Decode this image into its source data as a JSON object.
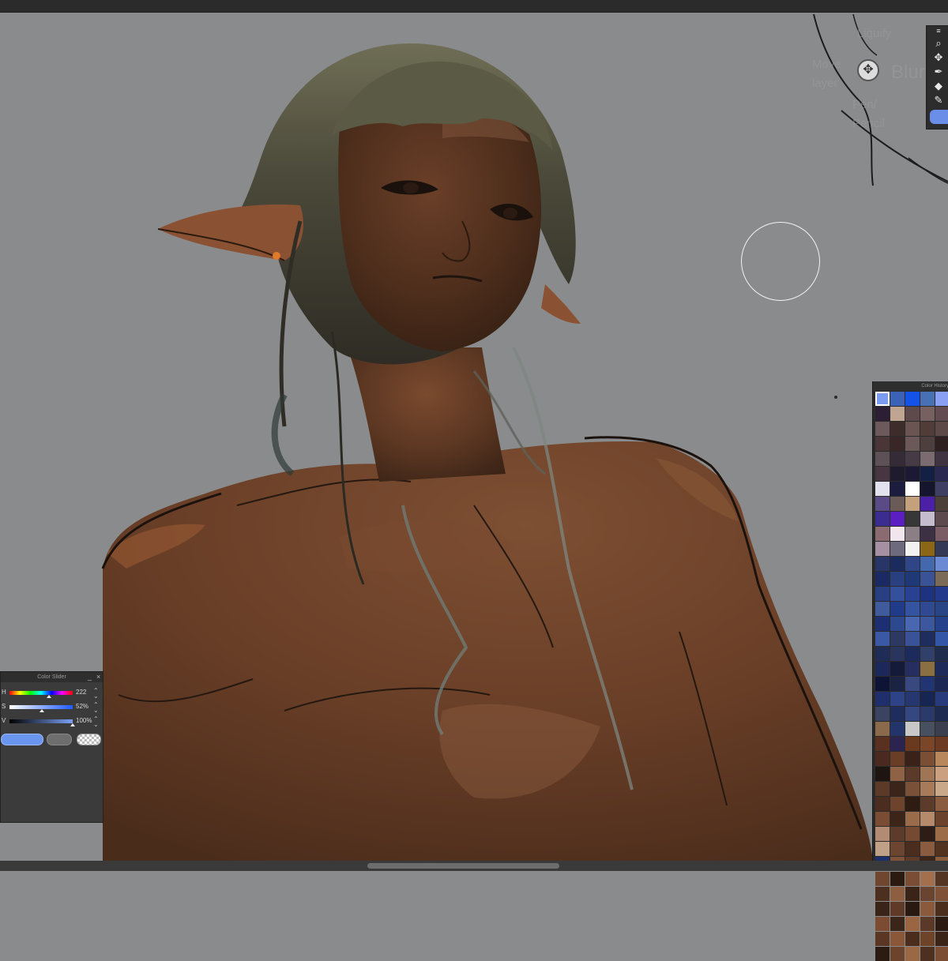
{
  "gesture_hints": {
    "liquify": "Liquify",
    "move_layer": "Move layer",
    "blur": "Blur",
    "pen_pencil": "Pen/ Pencil"
  },
  "toolbar": {
    "tools": [
      "search-icon",
      "move-icon",
      "pen-icon",
      "fill-icon",
      "pencil-icon"
    ]
  },
  "color_slider": {
    "title": "Color Slider",
    "rows": [
      {
        "label": "H",
        "value": "222",
        "fraction": 0.62
      },
      {
        "label": "S",
        "value": "52%",
        "fraction": 0.52
      },
      {
        "label": "V",
        "value": "100%",
        "fraction": 1.0
      }
    ],
    "main_color": "#6b96ef",
    "sub_color": "#6e6e6e"
  },
  "color_history": {
    "title": "Color History",
    "colors": [
      "#7b9cf0",
      "#3b62b6",
      "#1552e8",
      "#4870b5",
      "#8aa0f2",
      "#2c1f33",
      "#c0a592",
      "#5e4a4c",
      "#776060",
      "#624b51",
      "#6c5a5a",
      "#3e2c2a",
      "#6b5552",
      "#513d38",
      "#5d4947",
      "#4a3637",
      "#382726",
      "#6b5858",
      "#4e3e3e",
      "#2e2020",
      "#5e5057",
      "#352b36",
      "#463a46",
      "#7a6b70",
      "#403442",
      "#473542",
      "#1f1b2e",
      "#1b1934",
      "#141f45",
      "#2a2850",
      "#e2e2ee",
      "#1c1c3e",
      "#ffffff",
      "#15152e",
      "#3f3f63",
      "#5a4a86",
      "#6b5b58",
      "#c2a17c",
      "#4b1fa6",
      "#4c3f3a",
      "#3a2d8f",
      "#5a1ec2",
      "#373737",
      "#c5bcd0",
      "#5d4a4e",
      "#8a6b72",
      "#f2e6ee",
      "#8b7e85",
      "#3e3044",
      "#7a5d64",
      "#a58fa3",
      "#6d6a7e",
      "#f4f1f2",
      "#8a6616",
      "#343a55",
      "#273567",
      "#1c2b5d",
      "#2f4586",
      "#4368ae",
      "#6c89d3",
      "#1b2a63",
      "#284080",
      "#1f3977",
      "#3a5296",
      "#7a6a57",
      "#293f84",
      "#34509c",
      "#2a4191",
      "#1d3380",
      "#23398c",
      "#3f5b9b",
      "#1f3b89",
      "#3454a0",
      "#2f4992",
      "#294586",
      "#1d2f73",
      "#2c488f",
      "#4867b0",
      "#3b579e",
      "#25418c",
      "#3a58a4",
      "#2d3960",
      "#3a5298",
      "#1e2d5e",
      "#3356a6",
      "#1f2c55",
      "#2a355e",
      "#1c2b5c",
      "#31406a",
      "#1f2c4e",
      "#1c285a",
      "#141a3a",
      "#262e60",
      "#8a6f42",
      "#1d2a5a",
      "#0e1435",
      "#1b2344",
      "#3a4880",
      "#213574",
      "#1c2753",
      "#1e2f6c",
      "#2e4287",
      "#263770",
      "#172553",
      "#273b7c",
      "#3a4460",
      "#1e2c5e",
      "#344780",
      "#2a3a6a",
      "#1e2a50",
      "#8b6a4b",
      "#23346a",
      "#c8c8c8",
      "#47505e",
      "#3a3e4f",
      "#5a3020",
      "#2c2350",
      "#6b3a1e",
      "#7b4528",
      "#6c3a22",
      "#4a2a1f",
      "#6a3d26",
      "#3b2218",
      "#7a4f34",
      "#b8875c",
      "#1e1410",
      "#8f6245",
      "#5b3a29",
      "#a07555",
      "#caa080",
      "#5d3928",
      "#3b251a",
      "#7b5038",
      "#a77a5a",
      "#c9a789",
      "#4a2d1e",
      "#6d432c",
      "#2e1b12",
      "#5d3b2a",
      "#8a5d40",
      "#7a4c33",
      "#3c2518",
      "#9a6b4b",
      "#b58a6a",
      "#6b422c",
      "#b28b73",
      "#5c3b2b",
      "#744a33",
      "#2d1d14",
      "#9c6b48",
      "#c1a088",
      "#6b4530",
      "#4a2d1f",
      "#8a5b3f",
      "#51331f",
      "#1d2f6b",
      "#7d5238",
      "#5e3b28",
      "#3c2418",
      "#8c5c3e",
      "#6f472f",
      "#2b1a10",
      "#7a4e34",
      "#a36f4c",
      "#543422",
      "#4d2f1f",
      "#8e5e40",
      "#3a2317",
      "#6b4430",
      "#7f5238",
      "#3a2418",
      "#5f3b27",
      "#2a1910",
      "#8b5a3a",
      "#4c2e1d",
      "#7b4c31",
      "#3b2418",
      "#9a6542",
      "#5b3827",
      "#2b1a11",
      "#5a3723",
      "#8a5839",
      "#4a2d1d",
      "#6e4429",
      "#3a2417",
      "#2c1b12",
      "#6c432b",
      "#9b6846",
      "#4d301f",
      "#7b4e33"
    ]
  }
}
